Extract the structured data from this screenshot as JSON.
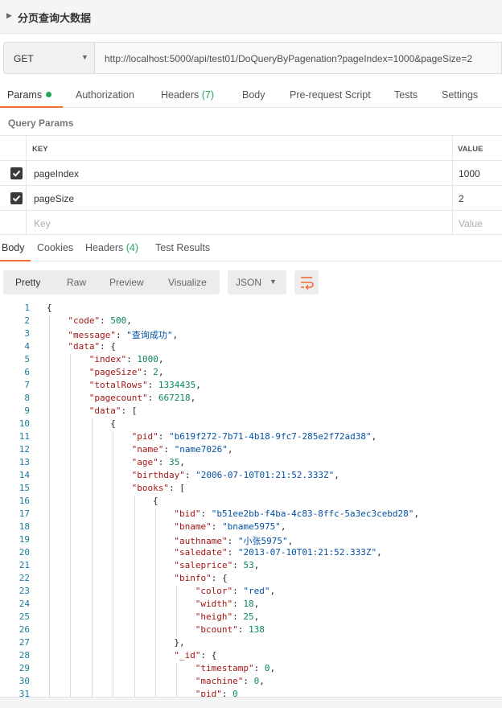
{
  "request": {
    "title": "分页查询大数据"
  },
  "url_bar": {
    "method": "GET",
    "url": "http://localhost:5000/api/test01/DoQueryByPagenation?pageIndex=1000&pageSize=2"
  },
  "request_tabs": [
    {
      "label": "Params"
    },
    {
      "label": "Authorization"
    },
    {
      "label": "Headers",
      "count": "(7)"
    },
    {
      "label": "Body"
    },
    {
      "label": "Pre-request Script"
    },
    {
      "label": "Tests"
    },
    {
      "label": "Settings"
    }
  ],
  "query_params": {
    "title": "Query Params",
    "headers": {
      "key": "KEY",
      "value": "VALUE"
    },
    "rows": [
      {
        "key": "pageIndex",
        "value": "1000",
        "checked": true
      },
      {
        "key": "pageSize",
        "value": "2",
        "checked": true
      }
    ],
    "placeholder": {
      "key": "Key",
      "value": "Value"
    }
  },
  "response_tabs": [
    {
      "label": "Body"
    },
    {
      "label": "Cookies"
    },
    {
      "label": "Headers",
      "count": "(4)"
    },
    {
      "label": "Test Results"
    }
  ],
  "view_modes": [
    "Pretty",
    "Raw",
    "Preview",
    "Visualize"
  ],
  "format": "JSON",
  "colors": {
    "accent": "#f26b3a",
    "green": "#26a55a"
  },
  "code_lines": [
    {
      "n": "1",
      "i": 0,
      "t": [
        [
          "p",
          "{"
        ]
      ]
    },
    {
      "n": "2",
      "i": 1,
      "t": [
        [
          "k",
          "\"code\""
        ],
        [
          "p",
          ": "
        ],
        [
          "n",
          "500"
        ],
        [
          "p",
          ","
        ]
      ]
    },
    {
      "n": "3",
      "i": 1,
      "t": [
        [
          "k",
          "\"message\""
        ],
        [
          "p",
          ": "
        ],
        [
          "s",
          "\"查询成功\""
        ],
        [
          "p",
          ","
        ]
      ]
    },
    {
      "n": "4",
      "i": 1,
      "t": [
        [
          "k",
          "\"data\""
        ],
        [
          "p",
          ": {"
        ]
      ]
    },
    {
      "n": "5",
      "i": 2,
      "t": [
        [
          "k",
          "\"index\""
        ],
        [
          "p",
          ": "
        ],
        [
          "n",
          "1000"
        ],
        [
          "p",
          ","
        ]
      ]
    },
    {
      "n": "6",
      "i": 2,
      "t": [
        [
          "k",
          "\"pageSize\""
        ],
        [
          "p",
          ": "
        ],
        [
          "n",
          "2"
        ],
        [
          "p",
          ","
        ]
      ]
    },
    {
      "n": "7",
      "i": 2,
      "t": [
        [
          "k",
          "\"totalRows\""
        ],
        [
          "p",
          ": "
        ],
        [
          "n",
          "1334435"
        ],
        [
          "p",
          ","
        ]
      ]
    },
    {
      "n": "8",
      "i": 2,
      "t": [
        [
          "k",
          "\"pagecount\""
        ],
        [
          "p",
          ": "
        ],
        [
          "n",
          "667218"
        ],
        [
          "p",
          ","
        ]
      ]
    },
    {
      "n": "9",
      "i": 2,
      "t": [
        [
          "k",
          "\"data\""
        ],
        [
          "p",
          ": ["
        ]
      ]
    },
    {
      "n": "10",
      "i": 3,
      "t": [
        [
          "p",
          "{"
        ]
      ]
    },
    {
      "n": "11",
      "i": 4,
      "t": [
        [
          "k",
          "\"pid\""
        ],
        [
          "p",
          ": "
        ],
        [
          "s",
          "\"b619f272-7b71-4b18-9fc7-285e2f72ad38\""
        ],
        [
          "p",
          ","
        ]
      ]
    },
    {
      "n": "12",
      "i": 4,
      "t": [
        [
          "k",
          "\"name\""
        ],
        [
          "p",
          ": "
        ],
        [
          "s",
          "\"name7026\""
        ],
        [
          "p",
          ","
        ]
      ]
    },
    {
      "n": "13",
      "i": 4,
      "t": [
        [
          "k",
          "\"age\""
        ],
        [
          "p",
          ": "
        ],
        [
          "n",
          "35"
        ],
        [
          "p",
          ","
        ]
      ]
    },
    {
      "n": "14",
      "i": 4,
      "t": [
        [
          "k",
          "\"birthday\""
        ],
        [
          "p",
          ": "
        ],
        [
          "s",
          "\"2006-07-10T01:21:52.333Z\""
        ],
        [
          "p",
          ","
        ]
      ]
    },
    {
      "n": "15",
      "i": 4,
      "t": [
        [
          "k",
          "\"books\""
        ],
        [
          "p",
          ": ["
        ]
      ]
    },
    {
      "n": "16",
      "i": 5,
      "t": [
        [
          "p",
          "{"
        ]
      ]
    },
    {
      "n": "17",
      "i": 6,
      "t": [
        [
          "k",
          "\"bid\""
        ],
        [
          "p",
          ": "
        ],
        [
          "s",
          "\"b51ee2bb-f4ba-4c83-8ffc-5a3ec3cebd28\""
        ],
        [
          "p",
          ","
        ]
      ]
    },
    {
      "n": "18",
      "i": 6,
      "t": [
        [
          "k",
          "\"bname\""
        ],
        [
          "p",
          ": "
        ],
        [
          "s",
          "\"bname5975\""
        ],
        [
          "p",
          ","
        ]
      ]
    },
    {
      "n": "19",
      "i": 6,
      "t": [
        [
          "k",
          "\"authname\""
        ],
        [
          "p",
          ": "
        ],
        [
          "s",
          "\"小张5975\""
        ],
        [
          "p",
          ","
        ]
      ]
    },
    {
      "n": "20",
      "i": 6,
      "t": [
        [
          "k",
          "\"saledate\""
        ],
        [
          "p",
          ": "
        ],
        [
          "s",
          "\"2013-07-10T01:21:52.333Z\""
        ],
        [
          "p",
          ","
        ]
      ]
    },
    {
      "n": "21",
      "i": 6,
      "t": [
        [
          "k",
          "\"saleprice\""
        ],
        [
          "p",
          ": "
        ],
        [
          "n",
          "53"
        ],
        [
          "p",
          ","
        ]
      ]
    },
    {
      "n": "22",
      "i": 6,
      "t": [
        [
          "k",
          "\"binfo\""
        ],
        [
          "p",
          ": {"
        ]
      ]
    },
    {
      "n": "23",
      "i": 7,
      "t": [
        [
          "k",
          "\"color\""
        ],
        [
          "p",
          ": "
        ],
        [
          "s",
          "\"red\""
        ],
        [
          "p",
          ","
        ]
      ]
    },
    {
      "n": "24",
      "i": 7,
      "t": [
        [
          "k",
          "\"width\""
        ],
        [
          "p",
          ": "
        ],
        [
          "n",
          "18"
        ],
        [
          "p",
          ","
        ]
      ]
    },
    {
      "n": "25",
      "i": 7,
      "t": [
        [
          "k",
          "\"heigh\""
        ],
        [
          "p",
          ": "
        ],
        [
          "n",
          "25"
        ],
        [
          "p",
          ","
        ]
      ]
    },
    {
      "n": "26",
      "i": 7,
      "t": [
        [
          "k",
          "\"bcount\""
        ],
        [
          "p",
          ": "
        ],
        [
          "n",
          "138"
        ]
      ]
    },
    {
      "n": "27",
      "i": 6,
      "t": [
        [
          "p",
          "},"
        ]
      ]
    },
    {
      "n": "28",
      "i": 6,
      "t": [
        [
          "k",
          "\"_id\""
        ],
        [
          "p",
          ": {"
        ]
      ]
    },
    {
      "n": "29",
      "i": 7,
      "t": [
        [
          "k",
          "\"timestamp\""
        ],
        [
          "p",
          ": "
        ],
        [
          "n",
          "0"
        ],
        [
          "p",
          ","
        ]
      ]
    },
    {
      "n": "30",
      "i": 7,
      "t": [
        [
          "k",
          "\"machine\""
        ],
        [
          "p",
          ": "
        ],
        [
          "n",
          "0"
        ],
        [
          "p",
          ","
        ]
      ]
    },
    {
      "n": "31",
      "i": 7,
      "t": [
        [
          "k",
          "\"pid\""
        ],
        [
          "p",
          ": "
        ],
        [
          "n",
          "0"
        ]
      ]
    }
  ]
}
